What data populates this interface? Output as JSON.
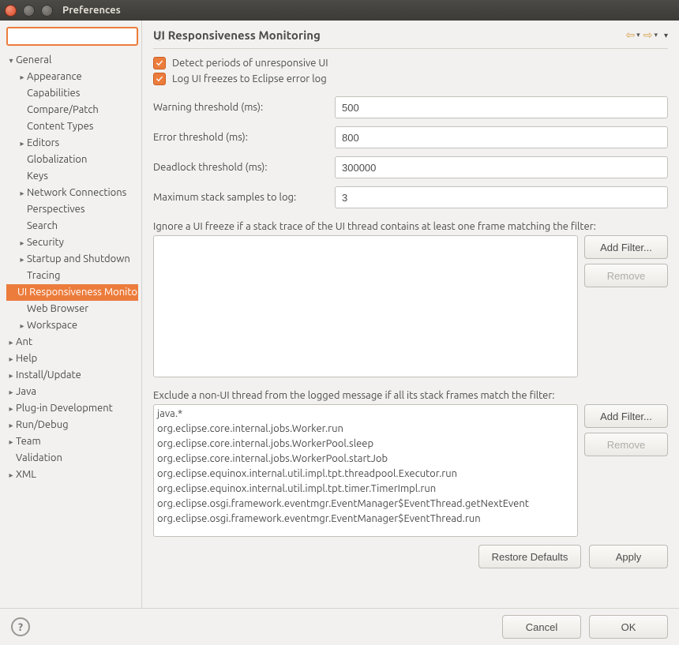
{
  "window": {
    "title": "Preferences"
  },
  "sidebar": {
    "filter_value": "",
    "items": [
      {
        "label": "General",
        "indent": 0,
        "exp": "down",
        "sel": false
      },
      {
        "label": "Appearance",
        "indent": 1,
        "exp": "right",
        "sel": false
      },
      {
        "label": "Capabilities",
        "indent": 1,
        "exp": "none",
        "sel": false
      },
      {
        "label": "Compare/Patch",
        "indent": 1,
        "exp": "none",
        "sel": false
      },
      {
        "label": "Content Types",
        "indent": 1,
        "exp": "none",
        "sel": false
      },
      {
        "label": "Editors",
        "indent": 1,
        "exp": "right",
        "sel": false
      },
      {
        "label": "Globalization",
        "indent": 1,
        "exp": "none",
        "sel": false
      },
      {
        "label": "Keys",
        "indent": 1,
        "exp": "none",
        "sel": false
      },
      {
        "label": "Network Connections",
        "indent": 1,
        "exp": "right",
        "sel": false
      },
      {
        "label": "Perspectives",
        "indent": 1,
        "exp": "none",
        "sel": false
      },
      {
        "label": "Search",
        "indent": 1,
        "exp": "none",
        "sel": false
      },
      {
        "label": "Security",
        "indent": 1,
        "exp": "right",
        "sel": false
      },
      {
        "label": "Startup and Shutdown",
        "indent": 1,
        "exp": "right",
        "sel": false
      },
      {
        "label": "Tracing",
        "indent": 1,
        "exp": "none",
        "sel": false
      },
      {
        "label": "UI Responsiveness Monitoring",
        "indent": 1,
        "exp": "none",
        "sel": true
      },
      {
        "label": "Web Browser",
        "indent": 1,
        "exp": "none",
        "sel": false
      },
      {
        "label": "Workspace",
        "indent": 1,
        "exp": "right",
        "sel": false
      },
      {
        "label": "Ant",
        "indent": 0,
        "exp": "right",
        "sel": false
      },
      {
        "label": "Help",
        "indent": 0,
        "exp": "right",
        "sel": false
      },
      {
        "label": "Install/Update",
        "indent": 0,
        "exp": "right",
        "sel": false
      },
      {
        "label": "Java",
        "indent": 0,
        "exp": "right",
        "sel": false
      },
      {
        "label": "Plug-in Development",
        "indent": 0,
        "exp": "right",
        "sel": false
      },
      {
        "label": "Run/Debug",
        "indent": 0,
        "exp": "right",
        "sel": false
      },
      {
        "label": "Team",
        "indent": 0,
        "exp": "right",
        "sel": false
      },
      {
        "label": "Validation",
        "indent": 0,
        "exp": "none",
        "sel": false
      },
      {
        "label": "XML",
        "indent": 0,
        "exp": "right",
        "sel": false
      }
    ]
  },
  "page": {
    "title": "UI Responsiveness Monitoring",
    "chk_detect": "Detect periods of unresponsive UI",
    "chk_log": "Log UI freezes to Eclipse error log",
    "lbl_warning": "Warning threshold (ms):",
    "val_warning": "500",
    "lbl_error": "Error threshold (ms):",
    "val_error": "800",
    "lbl_deadlock": "Deadlock threshold (ms):",
    "val_deadlock": "300000",
    "lbl_max": "Maximum stack samples to log:",
    "val_max": "3",
    "lbl_ignore": "Ignore a UI freeze if a stack trace of the UI thread contains at least one frame matching the filter:",
    "lbl_exclude": "Exclude a non-UI thread from the logged message if all its stack frames match the filter:",
    "exclude_filters": [
      "java.*",
      "org.eclipse.core.internal.jobs.Worker.run",
      "org.eclipse.core.internal.jobs.WorkerPool.sleep",
      "org.eclipse.core.internal.jobs.WorkerPool.startJob",
      "org.eclipse.equinox.internal.util.impl.tpt.threadpool.Executor.run",
      "org.eclipse.equinox.internal.util.impl.tpt.timer.TimerImpl.run",
      "org.eclipse.osgi.framework.eventmgr.EventManager$EventThread.getNextEvent",
      "org.eclipse.osgi.framework.eventmgr.EventManager$EventThread.run"
    ],
    "btn_add_filter": "Add Filter...",
    "btn_remove": "Remove",
    "btn_restore": "Restore Defaults",
    "btn_apply": "Apply"
  },
  "footer": {
    "btn_cancel": "Cancel",
    "btn_ok": "OK"
  }
}
